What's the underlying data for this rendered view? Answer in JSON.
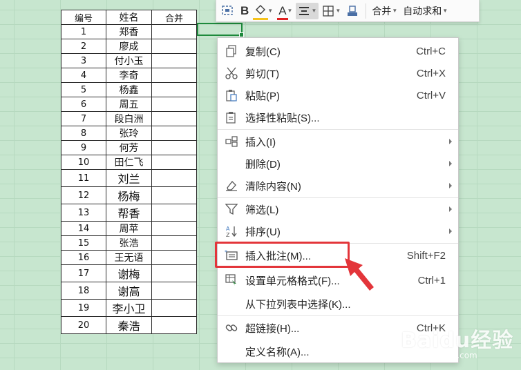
{
  "sheet": {
    "headers": [
      "编号",
      "姓名",
      "合并"
    ],
    "rows": [
      {
        "no": "1",
        "name": "郑香"
      },
      {
        "no": "2",
        "name": "廖成"
      },
      {
        "no": "3",
        "name": "付小玉"
      },
      {
        "no": "4",
        "name": "李奇"
      },
      {
        "no": "5",
        "name": "杨鑫"
      },
      {
        "no": "6",
        "name": "周五"
      },
      {
        "no": "7",
        "name": "段白洲"
      },
      {
        "no": "8",
        "name": "张玲"
      },
      {
        "no": "9",
        "name": "何芳"
      },
      {
        "no": "10",
        "name": "田仁飞"
      },
      {
        "no": "11",
        "name": "刘兰"
      },
      {
        "no": "12",
        "name": "杨梅"
      },
      {
        "no": "13",
        "name": "帮香"
      },
      {
        "no": "14",
        "name": "周苹"
      },
      {
        "no": "15",
        "name": "张浩"
      },
      {
        "no": "16",
        "name": "王无语"
      },
      {
        "no": "17",
        "name": "谢梅"
      },
      {
        "no": "18",
        "name": "谢高"
      },
      {
        "no": "19",
        "name": "李小卫"
      },
      {
        "no": "20",
        "name": "秦浩"
      }
    ]
  },
  "toolbar": {
    "bold": "B",
    "font_color": "A",
    "merge_label": "合并",
    "autosum_label": "自动求和"
  },
  "menu": {
    "copy": {
      "label": "复制(C)",
      "shortcut": "Ctrl+C"
    },
    "cut": {
      "label": "剪切(T)",
      "shortcut": "Ctrl+X"
    },
    "paste": {
      "label": "粘贴(P)",
      "shortcut": "Ctrl+V"
    },
    "paste_special": {
      "label": "选择性粘贴(S)..."
    },
    "insert": {
      "label": "插入(I)"
    },
    "delete": {
      "label": "删除(D)"
    },
    "clear": {
      "label": "清除内容(N)"
    },
    "filter": {
      "label": "筛选(L)"
    },
    "sort": {
      "label": "排序(U)"
    },
    "insert_comment": {
      "label": "插入批注(M)...",
      "shortcut": "Shift+F2"
    },
    "format_cells": {
      "label": "设置单元格格式(F)...",
      "shortcut": "Ctrl+1"
    },
    "pick_list": {
      "label": "从下拉列表中选择(K)..."
    },
    "hyperlink": {
      "label": "超链接(H)...",
      "shortcut": "Ctrl+K"
    },
    "define_name": {
      "label": "定义名称(A)..."
    }
  },
  "watermark": {
    "text": "Baidu经验",
    "url": "jingyan.baidu.com"
  },
  "colors": {
    "sheet_bg": "#c7e6cf",
    "highlight": "#e3353a",
    "active_cell": "#1e8a3c"
  }
}
